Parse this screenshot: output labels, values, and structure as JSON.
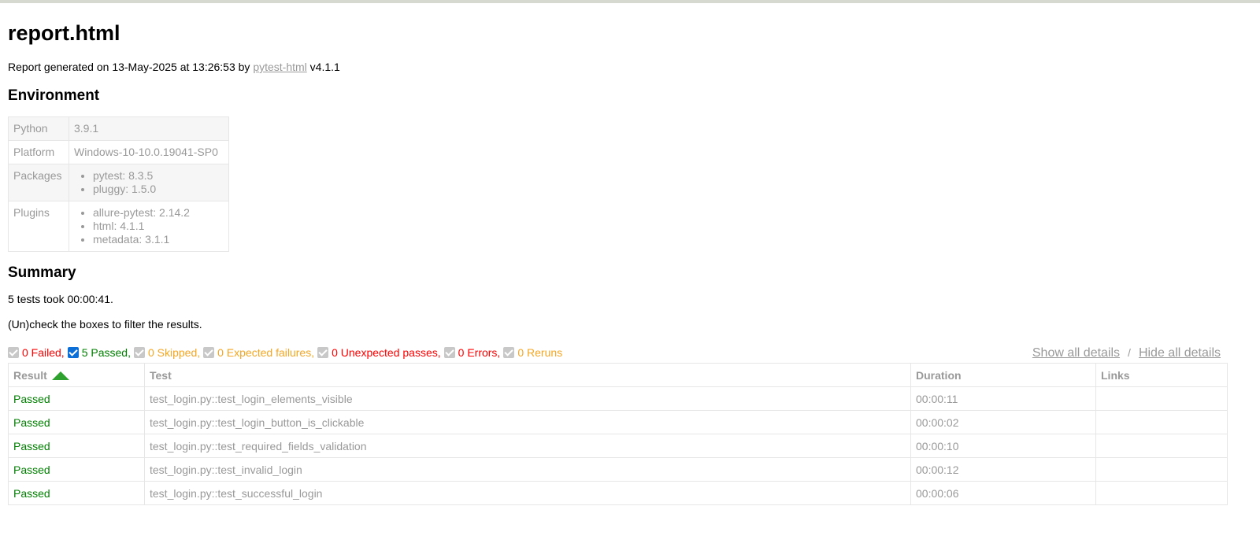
{
  "title": "report.html",
  "generated": {
    "prefix": "Report generated on 13-May-2025 at 13:26:53 by ",
    "link": "pytest-html",
    "suffix": " v4.1.1"
  },
  "environment": {
    "heading": "Environment",
    "rows": {
      "python": {
        "key": "Python",
        "value": "3.9.1"
      },
      "platform": {
        "key": "Platform",
        "value": "Windows-10-10.0.19041-SP0"
      },
      "packages": {
        "key": "Packages",
        "items": [
          "pytest: 8.3.5",
          "pluggy: 1.5.0"
        ]
      },
      "plugins": {
        "key": "Plugins",
        "items": [
          "allure-pytest: 2.14.2",
          "html: 4.1.1",
          "metadata: 3.1.1"
        ]
      }
    }
  },
  "summary": {
    "heading": "Summary",
    "took": "5 tests took 00:00:41.",
    "hint": "(Un)check the boxes to filter the results."
  },
  "filters": {
    "failed": {
      "label": "0 Failed,",
      "checked": false,
      "color": "#ff0000"
    },
    "passed": {
      "label": "5 Passed,",
      "checked": true,
      "color": "#008000"
    },
    "skipped": {
      "label": "0 Skipped,",
      "checked": false,
      "color": "#f5a623"
    },
    "xfailed": {
      "label": "0 Expected failures,",
      "checked": false,
      "color": "#f5a623"
    },
    "xpassed": {
      "label": "0 Unexpected passes,",
      "checked": false,
      "color": "#ff0000"
    },
    "errors": {
      "label": "0 Errors,",
      "checked": false,
      "color": "#ff0000"
    },
    "reruns": {
      "label": "0 Reruns",
      "checked": false,
      "color": "#f5a623"
    }
  },
  "details_links": {
    "show": "Show all details",
    "separator": "/",
    "hide": "Hide all details"
  },
  "results": {
    "headers": {
      "result": "Result",
      "test": "Test",
      "duration": "Duration",
      "links": "Links"
    },
    "sort_icon": "sort-ascending-icon",
    "rows": [
      {
        "result": "Passed",
        "test": "test_login.py::test_login_elements_visible",
        "duration": "00:00:11",
        "links": ""
      },
      {
        "result": "Passed",
        "test": "test_login.py::test_login_button_is_clickable",
        "duration": "00:00:02",
        "links": ""
      },
      {
        "result": "Passed",
        "test": "test_login.py::test_required_fields_validation",
        "duration": "00:00:10",
        "links": ""
      },
      {
        "result": "Passed",
        "test": "test_login.py::test_invalid_login",
        "duration": "00:00:12",
        "links": ""
      },
      {
        "result": "Passed",
        "test": "test_login.py::test_successful_login",
        "duration": "00:00:06",
        "links": ""
      }
    ]
  }
}
